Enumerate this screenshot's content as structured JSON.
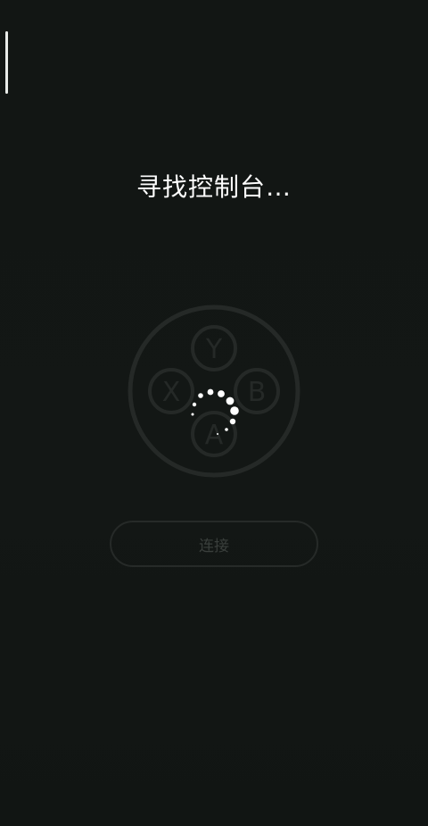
{
  "screen": {
    "title": "寻找控制台…",
    "connect_label": "连接"
  },
  "controller": {
    "buttons": [
      "Y",
      "X",
      "B",
      "A"
    ],
    "icon": "controller-face-buttons-icon",
    "color": "#262a28"
  },
  "spinner": {
    "icon": "loading-spinner-icon",
    "color": "#ffffff"
  },
  "edge_handle": {
    "icon": "edge-swipe-handle-icon"
  }
}
